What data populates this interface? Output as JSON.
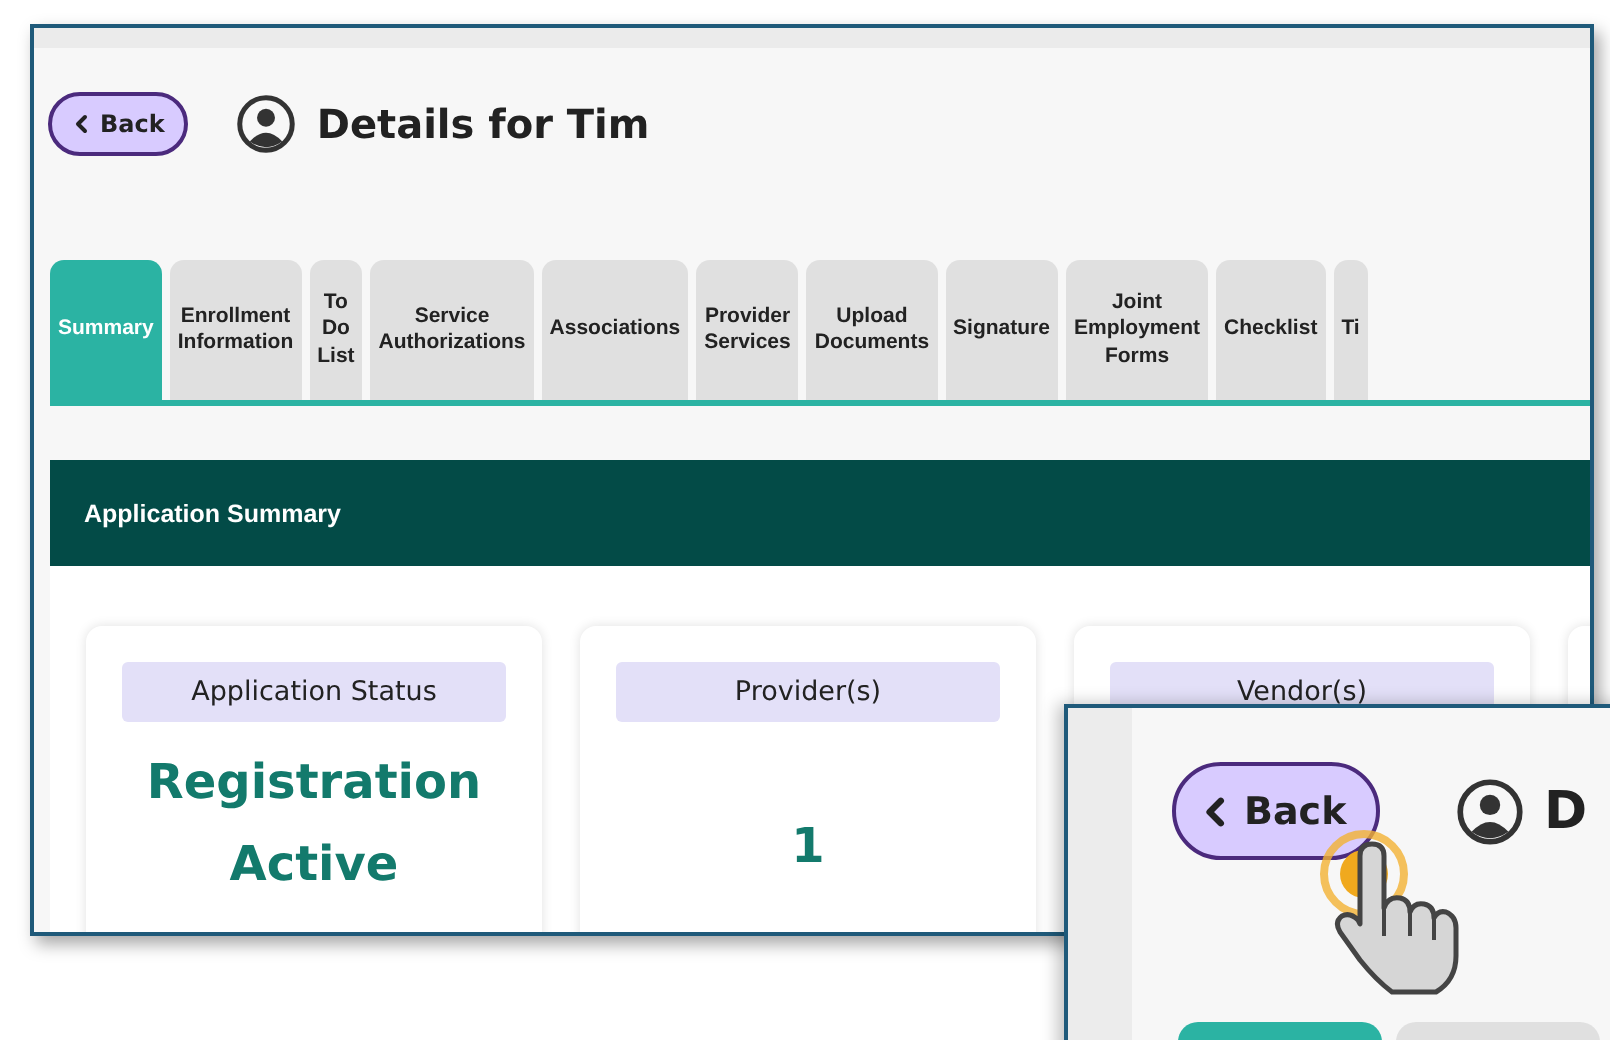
{
  "header": {
    "back_button": "Back",
    "title": "Details for Tim"
  },
  "tabs": [
    {
      "label": "Summary",
      "selected": true
    },
    {
      "label": "Enrollment\nInformation",
      "selected": false
    },
    {
      "label": "To\nDo\nList",
      "selected": false
    },
    {
      "label": "Service\nAuthorizations",
      "selected": false
    },
    {
      "label": "Associations",
      "selected": false
    },
    {
      "label": "Provider\nServices",
      "selected": false
    },
    {
      "label": "Upload\nDocuments",
      "selected": false
    },
    {
      "label": "Signature",
      "selected": false
    },
    {
      "label": "Joint\nEmployment\nForms",
      "selected": false
    },
    {
      "label": "Checklist",
      "selected": false
    },
    {
      "label": "Ti",
      "selected": false
    }
  ],
  "panel": {
    "title": "Application Summary",
    "cards": [
      {
        "label": "Application Status",
        "value": "Registration\nActive"
      },
      {
        "label": "Provider(s)",
        "value": "1"
      },
      {
        "label": "Vendor(s)"
      }
    ]
  },
  "zoom_inset": {
    "back_button": "Back",
    "title": "D",
    "tabs": [
      {
        "selected": true
      },
      {
        "selected": false
      }
    ]
  }
}
